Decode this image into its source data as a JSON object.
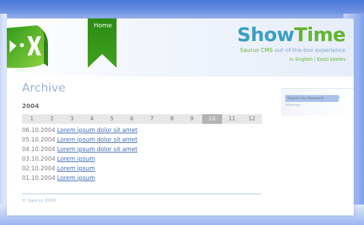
{
  "nav": {
    "home_label": "Home"
  },
  "brand": {
    "title_part1": "Show",
    "title_part2": "Time",
    "tagline_cms": "Saurus CMS",
    "tagline_rest": " out-of-the-box experience",
    "lang_en": "In English",
    "lang_sep": "|",
    "lang_et": "Eesti keeles"
  },
  "archive": {
    "title": "Archive",
    "year": "2004",
    "months": [
      "1",
      "2",
      "3",
      "4",
      "5",
      "6",
      "7",
      "8",
      "9",
      "10",
      "11",
      "12"
    ],
    "active_month": "10",
    "entries": [
      {
        "date": "06.10.2004",
        "title": "Lorem ipsum dolor sit amet"
      },
      {
        "date": "05.10.2004",
        "title": "Lorem ipsum dolor sit amet"
      },
      {
        "date": "04.10.2004",
        "title": "Lorem ipsum dolor sit amet"
      },
      {
        "date": "03.10.2004",
        "title": "Lorem ipsum"
      },
      {
        "date": "02.10.2004",
        "title": "Lorem ipsum"
      },
      {
        "date": "01.10.2004",
        "title": "Lorem ipsum"
      }
    ]
  },
  "sidebar": {
    "search_placeholder": "Search by Keyword",
    "search_go": "»",
    "sitemap": "sitemap"
  },
  "footer": {
    "copyright": "© Saurus 2005"
  },
  "colors": {
    "brand_blue": "#3a9fc6",
    "brand_green": "#63b530",
    "link": "#3f6bb3",
    "frame_blue": "#6f92e2"
  },
  "icons": {
    "logo": "saurus-logo-icon",
    "flag": "home-flag-icon",
    "search_go": "arrow-icon"
  }
}
